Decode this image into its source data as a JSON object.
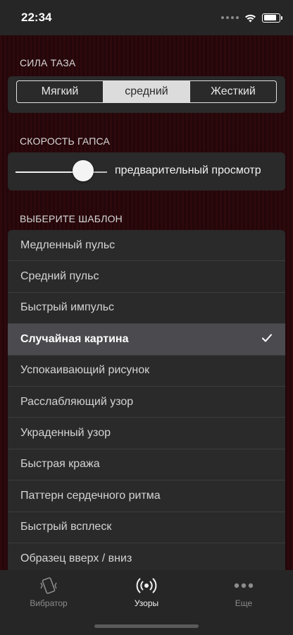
{
  "status_bar": {
    "time": "22:34",
    "battery_level": 0.95
  },
  "strength": {
    "header": "СИЛА ТАЗА",
    "options": [
      "Мягкий",
      "средний",
      "Жесткий"
    ],
    "selected_index": 1
  },
  "speed": {
    "header": "СКОРОСТЬ ГАПСА",
    "slider_value": 0.74,
    "preview_label": "предварительный просмотр"
  },
  "patterns": {
    "header": "ВЫБЕРИТЕ ШАБЛОН",
    "items": [
      "Медленный пульс",
      "Средний пульс",
      "Быстрый импульс",
      "Случайная картина",
      "Успокаивающий рисунок",
      "Расслабляющий узор",
      "Украденный узор",
      "Быстрая кража",
      "Паттерн сердечного ритма",
      "Быстрый всплеск",
      "Образец вверх / вниз"
    ],
    "selected_index": 3
  },
  "tabs": [
    {
      "label": "Вибратор",
      "icon": "vibrate-phone-icon"
    },
    {
      "label": "Узоры",
      "icon": "radio-waves-icon"
    },
    {
      "label": "Еще",
      "icon": "more-dots-icon"
    }
  ],
  "active_tab_index": 1,
  "colors": {
    "background": "#2b080b",
    "card": "#2a2a2a",
    "selected_row": "#4a4a4f"
  }
}
